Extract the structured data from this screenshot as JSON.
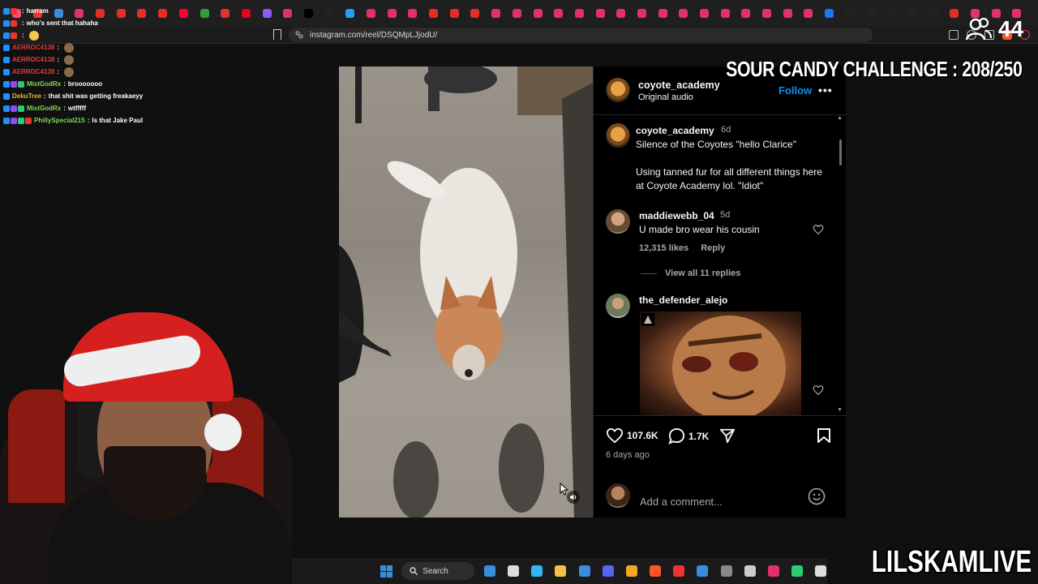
{
  "browser": {
    "url": "instagram.com/reel/DSQMpLJjodU/",
    "tab_favicon_colors": [
      "#ff4d6d",
      "#e33",
      "#3a8dde",
      "#e1306c",
      "#e52d27",
      "#e52d27",
      "#e52d27",
      "#e52d27",
      "#ff0033",
      "#2e9d3a",
      "#d33",
      "#e60023",
      "#8b5cf6",
      "#e1306c",
      "#000",
      "#222",
      "#1da1f2",
      "#e1306c",
      "#e1306c",
      "#e1306c",
      "#e52d27",
      "#e52d27",
      "#e52d27",
      "#e1306c",
      "#e1306c",
      "#e1306c",
      "#e1306c",
      "#e1306c",
      "#e1306c",
      "#e1306c",
      "#e1306c",
      "#e1306c",
      "#e1306c",
      "#e1306c",
      "#e1306c",
      "#e1306c",
      "#e1306c",
      "#e1306c",
      "#e1306c",
      "#1877f2",
      "#222",
      "#222",
      "#222",
      "#222",
      "#222",
      "#e52d27",
      "#e1306c",
      "#e1306c",
      "#e1306c"
    ]
  },
  "overlay": {
    "viewer_count": "44",
    "viewer_icon": "people-icon",
    "challenge": "SOUR CANDY CHALLENGE : 208/250",
    "brand": "LILSKAMLIVE"
  },
  "chat": [
    {
      "user": "",
      "color": "#e23b3b",
      "message": "harram",
      "badges": [
        "#1e90ff",
        "#e33"
      ],
      "emote": false
    },
    {
      "user": "",
      "color": "#e23b3b",
      "message": "who's sent that hahaha",
      "badges": [
        "#1e90ff",
        "#e33"
      ],
      "emote": false
    },
    {
      "user": "",
      "color": "#e23b3b",
      "message": "",
      "badges": [
        "#1e90ff",
        "#e33"
      ],
      "emote": true
    },
    {
      "user": "AERROC4138",
      "color": "#e23b3b",
      "message": "",
      "badges": [
        "#1e90ff"
      ],
      "emote": true
    },
    {
      "user": "AERROC4138",
      "color": "#e23b3b",
      "message": "",
      "badges": [
        "#1e90ff"
      ],
      "emote": true
    },
    {
      "user": "AERROC4138",
      "color": "#e23b3b",
      "message": "",
      "badges": [
        "#1e90ff"
      ],
      "emote": true
    },
    {
      "user": "MistGodRx",
      "color": "#7fd858",
      "message": "brooooooo",
      "badges": [
        "#1e90ff",
        "#9146ff",
        "#2ecc71"
      ],
      "emote": false
    },
    {
      "user": "DekuTree",
      "color": "#e8b33a",
      "message": "that shit was getting freakaeyy",
      "badges": [
        "#1e90ff"
      ],
      "emote": false
    },
    {
      "user": "MistGodRx",
      "color": "#7fd858",
      "message": "wtfffff",
      "badges": [
        "#1e90ff",
        "#9146ff",
        "#2ecc71"
      ],
      "emote": false
    },
    {
      "user": "PhillySpecial215",
      "color": "#7fd858",
      "message": "Is that Jake Paul",
      "badges": [
        "#1e90ff",
        "#9146ff",
        "#2ecc71",
        "#e33"
      ],
      "emote": false
    }
  ],
  "post": {
    "author": "coyote_academy",
    "audio": "Original audio",
    "follow_label": "Follow",
    "more_label": "•••",
    "caption": {
      "user": "coyote_academy",
      "time": "6d",
      "text": "Silence of the Coyotes \"hello Clarice\"\n\nUsing tanned fur for all different things here at Coyote Academy lol. \"Idiot\""
    },
    "comments": [
      {
        "user": "maddiewebb_04",
        "time": "5d",
        "text": "U made bro wear his cousin",
        "likes": "12,315 likes",
        "reply": "Reply",
        "view_replies": "View all 11 replies"
      },
      {
        "user": "the_defender_alejo",
        "time": "",
        "text": "",
        "likes": "",
        "reply": "",
        "view_replies": ""
      }
    ],
    "like_count": "107.6K",
    "comment_count": "1.7K",
    "posted": "6 days ago",
    "add_comment_placeholder": "Add a comment..."
  },
  "taskbar": {
    "search_label": "Search",
    "icons": [
      "#3a8dde",
      "#dddddd",
      "#35b3f5",
      "#f5c04a",
      "#3a8dde",
      "#5865f2",
      "#f5a623",
      "#fb542b",
      "#e33",
      "#3a8dde",
      "#888",
      "#ccc",
      "#e1306c",
      "#2ecc71",
      "#ddd"
    ]
  }
}
